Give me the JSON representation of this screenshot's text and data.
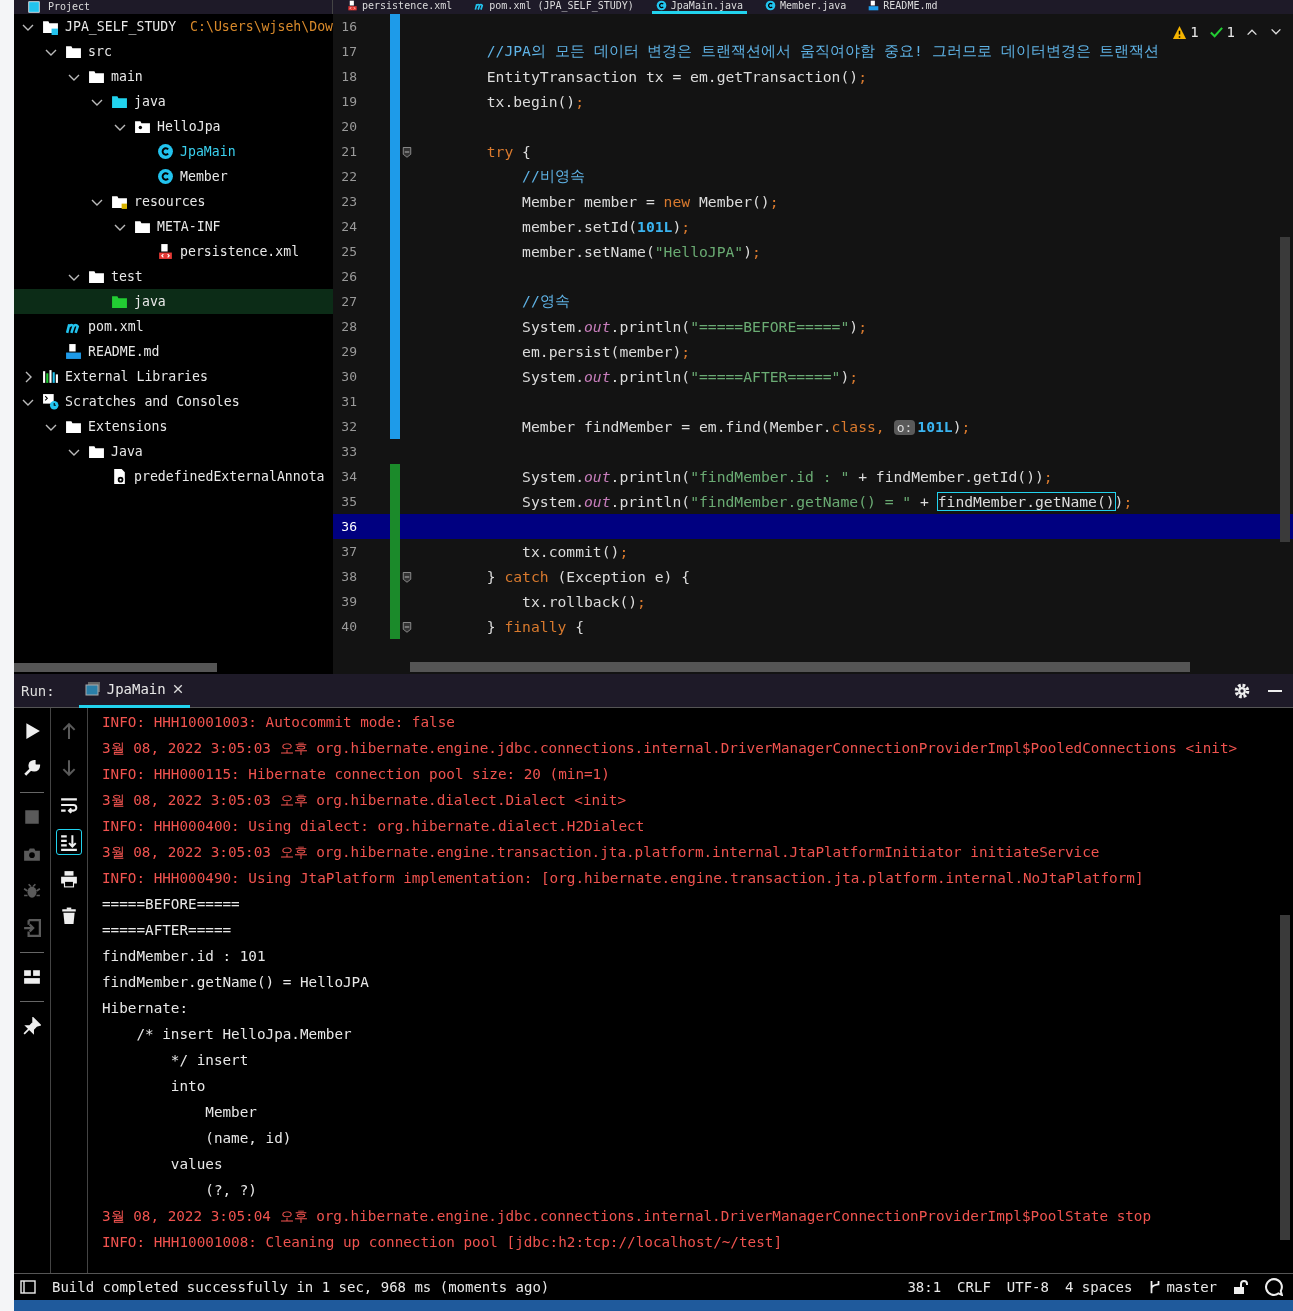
{
  "top_bar": {
    "panel_title": "Project",
    "tabs": [
      {
        "label": "persistence.xml",
        "kind": "xml",
        "selected": false
      },
      {
        "label": "pom.xml (JPA_SELF_STUDY)",
        "kind": "maven",
        "selected": false
      },
      {
        "label": "JpaMain.java",
        "kind": "class",
        "selected": true
      },
      {
        "label": "Member.java",
        "kind": "class",
        "selected": false
      },
      {
        "label": "README.md",
        "kind": "markdown",
        "selected": false
      }
    ]
  },
  "project_tree": [
    {
      "label": "JPA_SELF_STUDY",
      "path": "C:\\Users\\wjseh\\Dow",
      "kind": "module",
      "expanded": true,
      "selected": false,
      "children": [
        {
          "label": "src",
          "kind": "folder",
          "expanded": true,
          "selected": false,
          "children": [
            {
              "label": "main",
              "kind": "folder",
              "expanded": true,
              "selected": false,
              "children": [
                {
                  "label": "java",
                  "kind": "source",
                  "expanded": true,
                  "selected": false,
                  "children": [
                    {
                      "label": "HelloJpa",
                      "kind": "package",
                      "expanded": true,
                      "selected": false,
                      "children": [
                        {
                          "label": "JpaMain",
                          "kind": "class",
                          "active": true,
                          "selected": false
                        },
                        {
                          "label": "Member",
                          "kind": "class",
                          "active": false,
                          "selected": false
                        }
                      ]
                    }
                  ]
                },
                {
                  "label": "resources",
                  "kind": "resources",
                  "expanded": true,
                  "selected": false,
                  "children": [
                    {
                      "label": "META-INF",
                      "kind": "folder",
                      "expanded": true,
                      "selected": false,
                      "children": [
                        {
                          "label": "persistence.xml",
                          "kind": "xml",
                          "selected": false
                        }
                      ]
                    }
                  ]
                }
              ]
            },
            {
              "label": "test",
              "kind": "folder",
              "expanded": true,
              "selected": false,
              "children": [
                {
                  "label": "java",
                  "kind": "test",
                  "selected": true
                }
              ]
            }
          ]
        },
        {
          "label": "pom.xml",
          "kind": "maven",
          "selected": false
        },
        {
          "label": "README.md",
          "kind": "markdown",
          "selected": false
        }
      ]
    },
    {
      "label": "External Libraries",
      "kind": "library",
      "expanded": false,
      "selected": false
    },
    {
      "label": "Scratches and Consoles",
      "kind": "scratches",
      "expanded": true,
      "selected": false,
      "children": [
        {
          "label": "Extensions",
          "kind": "folder",
          "expanded": true,
          "selected": false,
          "children": [
            {
              "label": "Java",
              "kind": "folder",
              "expanded": true,
              "selected": false,
              "children": [
                {
                  "label": "predefinedExternalAnnota",
                  "kind": "config",
                  "selected": false
                }
              ]
            }
          ]
        }
      ]
    }
  ],
  "editor": {
    "inspections": {
      "warnings": "1",
      "passed": "1"
    },
    "lines": [
      {
        "number": "16",
        "modified": true,
        "added": false,
        "fold": false,
        "current": false
      },
      {
        "number": "17",
        "modified": true,
        "added": false,
        "fold": false,
        "current": false,
        "segments": [
          {
            "text": "        //JPA의 모든 데이터 변경은 트랜잭션에서 움직여야함 중요! 그러므로 데이터변경은 트랜잭션",
            "kind": "cmt"
          }
        ]
      },
      {
        "number": "18",
        "modified": true,
        "added": false,
        "fold": false,
        "current": false,
        "segments": [
          {
            "text": "        EntityTransaction tx = em.getTransaction()",
            "kind": "plain"
          },
          {
            "text": ";",
            "kind": "kw"
          }
        ]
      },
      {
        "number": "19",
        "modified": true,
        "added": false,
        "fold": false,
        "current": false,
        "segments": [
          {
            "text": "        tx.begin()",
            "kind": "plain"
          },
          {
            "text": ";",
            "kind": "kw"
          }
        ]
      },
      {
        "number": "20",
        "modified": true,
        "added": false,
        "fold": false,
        "current": false
      },
      {
        "number": "21",
        "modified": true,
        "added": false,
        "fold": true,
        "current": false,
        "segments": [
          {
            "text": "        try",
            "kind": "kw"
          },
          {
            "text": " {",
            "kind": "plain"
          }
        ]
      },
      {
        "number": "22",
        "modified": true,
        "added": false,
        "fold": false,
        "current": false,
        "segments": [
          {
            "text": "            //비영속",
            "kind": "cmt"
          }
        ]
      },
      {
        "number": "23",
        "modified": true,
        "added": false,
        "fold": false,
        "current": false,
        "segments": [
          {
            "text": "            Member member = ",
            "kind": "plain"
          },
          {
            "text": "new",
            "kind": "kw"
          },
          {
            "text": " Member()",
            "kind": "plain"
          },
          {
            "text": ";",
            "kind": "kw"
          }
        ]
      },
      {
        "number": "24",
        "modified": true,
        "added": false,
        "fold": false,
        "current": false,
        "segments": [
          {
            "text": "            member.setId(",
            "kind": "plain"
          },
          {
            "text": "101L",
            "kind": "num"
          },
          {
            "text": ")",
            "kind": "plain"
          },
          {
            "text": ";",
            "kind": "kw"
          }
        ]
      },
      {
        "number": "25",
        "modified": true,
        "added": false,
        "fold": false,
        "current": false,
        "segments": [
          {
            "text": "            member.setName(",
            "kind": "plain"
          },
          {
            "text": "\"HelloJPA\"",
            "kind": "str"
          },
          {
            "text": ")",
            "kind": "plain"
          },
          {
            "text": ";",
            "kind": "kw"
          }
        ]
      },
      {
        "number": "26",
        "modified": true,
        "added": false,
        "fold": false,
        "current": false
      },
      {
        "number": "27",
        "modified": true,
        "added": false,
        "fold": false,
        "current": false,
        "segments": [
          {
            "text": "            //영속",
            "kind": "cmt"
          }
        ]
      },
      {
        "number": "28",
        "modified": true,
        "added": false,
        "fold": false,
        "current": false,
        "segments": [
          {
            "text": "            System.",
            "kind": "plain"
          },
          {
            "text": "out",
            "kind": "field"
          },
          {
            "text": ".println(",
            "kind": "plain"
          },
          {
            "text": "\"=====BEFORE=====\"",
            "kind": "str"
          },
          {
            "text": ")",
            "kind": "plain"
          },
          {
            "text": ";",
            "kind": "kw"
          }
        ]
      },
      {
        "number": "29",
        "modified": true,
        "added": false,
        "fold": false,
        "current": false,
        "segments": [
          {
            "text": "            em.persist(member)",
            "kind": "plain"
          },
          {
            "text": ";",
            "kind": "kw"
          }
        ]
      },
      {
        "number": "30",
        "modified": true,
        "added": false,
        "fold": false,
        "current": false,
        "segments": [
          {
            "text": "            System.",
            "kind": "plain"
          },
          {
            "text": "out",
            "kind": "field"
          },
          {
            "text": ".println(",
            "kind": "plain"
          },
          {
            "text": "\"=====AFTER=====\"",
            "kind": "str"
          },
          {
            "text": ")",
            "kind": "plain"
          },
          {
            "text": ";",
            "kind": "kw"
          }
        ]
      },
      {
        "number": "31",
        "modified": true,
        "added": false,
        "fold": false,
        "current": false
      },
      {
        "number": "32",
        "modified": true,
        "added": false,
        "fold": false,
        "current": false,
        "segments": [
          {
            "text": "            Member findMember = em.find(Member.",
            "kind": "plain"
          },
          {
            "text": "class,",
            "kind": "kw"
          },
          {
            "text": "o:",
            "kind": "hint"
          },
          {
            "text": "101L",
            "kind": "num"
          },
          {
            "text": ")",
            "kind": "plain"
          },
          {
            "text": ";",
            "kind": "kw"
          }
        ]
      },
      {
        "number": "33",
        "modified": false,
        "added": false,
        "fold": false,
        "current": false
      },
      {
        "number": "34",
        "modified": false,
        "added": true,
        "fold": false,
        "current": false,
        "segments": [
          {
            "text": "            System.",
            "kind": "plain"
          },
          {
            "text": "out",
            "kind": "field"
          },
          {
            "text": ".println(",
            "kind": "plain"
          },
          {
            "text": "\"findMember.id : \"",
            "kind": "str"
          },
          {
            "text": " + findMember.getId())",
            "kind": "plain"
          },
          {
            "text": ";",
            "kind": "kw"
          }
        ]
      },
      {
        "number": "35",
        "modified": false,
        "added": true,
        "fold": false,
        "current": false,
        "segments": [
          {
            "text": "            System.",
            "kind": "plain"
          },
          {
            "text": "out",
            "kind": "field"
          },
          {
            "text": ".println(",
            "kind": "plain"
          },
          {
            "text": "\"findMember.getName() = \"",
            "kind": "str"
          },
          {
            "text": " + ",
            "kind": "plain"
          },
          {
            "text": "findMember.getName()",
            "kind": "boxed"
          },
          {
            "text": ")",
            "kind": "plain"
          },
          {
            "text": ";",
            "kind": "kw"
          }
        ]
      },
      {
        "number": "36",
        "modified": false,
        "added": true,
        "fold": false,
        "current": true
      },
      {
        "number": "37",
        "modified": false,
        "added": true,
        "fold": false,
        "current": false,
        "segments": [
          {
            "text": "            tx.commit()",
            "kind": "plain"
          },
          {
            "text": ";",
            "kind": "kw"
          }
        ]
      },
      {
        "number": "38",
        "modified": false,
        "added": true,
        "fold": true,
        "current": false,
        "segments": [
          {
            "text": "        } ",
            "kind": "plain"
          },
          {
            "text": "catch",
            "kind": "kw"
          },
          {
            "text": " (Exception e) {",
            "kind": "plain"
          }
        ]
      },
      {
        "number": "39",
        "modified": false,
        "added": true,
        "fold": false,
        "current": false,
        "segments": [
          {
            "text": "            tx.rollback()",
            "kind": "plain"
          },
          {
            "text": ";",
            "kind": "kw"
          }
        ]
      },
      {
        "number": "40",
        "modified": false,
        "added": true,
        "fold": true,
        "current": false,
        "segments": [
          {
            "text": "        } ",
            "kind": "plain"
          },
          {
            "text": "finally",
            "kind": "kw"
          },
          {
            "text": " {",
            "kind": "plain"
          }
        ]
      }
    ]
  },
  "run_panel": {
    "label": "Run:",
    "tab": {
      "label": "JpaMain",
      "selected": true
    },
    "tools_left": [
      {
        "kind": "run",
        "disabled": false
      },
      {
        "kind": "wrench",
        "disabled": false
      },
      {
        "kind": "stop",
        "disabled": true
      },
      {
        "kind": "camera",
        "disabled": true
      },
      {
        "kind": "bug",
        "disabled": true
      },
      {
        "kind": "exit",
        "disabled": true
      },
      {
        "kind": "layout",
        "disabled": false
      },
      {
        "kind": "pin",
        "disabled": false
      }
    ],
    "tools_right": [
      {
        "kind": "up",
        "disabled": true,
        "selected": false
      },
      {
        "kind": "down",
        "disabled": true,
        "selected": false
      },
      {
        "kind": "wrap",
        "disabled": false,
        "selected": false
      },
      {
        "kind": "scroll-end",
        "disabled": false,
        "selected": true
      },
      {
        "kind": "print",
        "disabled": false,
        "selected": false
      },
      {
        "kind": "trash",
        "disabled": false,
        "selected": false
      }
    ],
    "console": [
      {
        "text": "INFO: HHH10001003: Autocommit mode: false",
        "kind": "err"
      },
      {
        "text": "3월 08, 2022 3:05:03 오후 org.hibernate.engine.jdbc.connections.internal.DriverManagerConnectionProviderImpl$PooledConnections <init>",
        "kind": "err"
      },
      {
        "text": "INFO: HHH000115: Hibernate connection pool size: 20 (min=1)",
        "kind": "err"
      },
      {
        "text": "3월 08, 2022 3:05:03 오후 org.hibernate.dialect.Dialect <init>",
        "kind": "err"
      },
      {
        "text": "INFO: HHH000400: Using dialect: org.hibernate.dialect.H2Dialect",
        "kind": "err"
      },
      {
        "text": "3월 08, 2022 3:05:03 오후 org.hibernate.engine.transaction.jta.platform.internal.JtaPlatformInitiator initiateService",
        "kind": "err"
      },
      {
        "text": "INFO: HHH000490: Using JtaPlatform implementation: [org.hibernate.engine.transaction.jta.platform.internal.NoJtaPlatform]",
        "kind": "err"
      },
      {
        "text": "=====BEFORE=====",
        "kind": "out"
      },
      {
        "text": "=====AFTER=====",
        "kind": "out"
      },
      {
        "text": "findMember.id : 101",
        "kind": "out"
      },
      {
        "text": "findMember.getName() = HelloJPA",
        "kind": "out"
      },
      {
        "text": "Hibernate: ",
        "kind": "out"
      },
      {
        "text": "    /* insert HelloJpa.Member",
        "kind": "out"
      },
      {
        "text": "        */ insert ",
        "kind": "out"
      },
      {
        "text": "        into",
        "kind": "out"
      },
      {
        "text": "            Member",
        "kind": "out"
      },
      {
        "text": "            (name, id) ",
        "kind": "out"
      },
      {
        "text": "        values",
        "kind": "out"
      },
      {
        "text": "            (?, ?)",
        "kind": "out"
      },
      {
        "text": "3월 08, 2022 3:05:04 오후 org.hibernate.engine.jdbc.connections.internal.DriverManagerConnectionProviderImpl$PoolState stop",
        "kind": "err"
      },
      {
        "text": "INFO: HHH10001008: Cleaning up connection pool [jdbc:h2:tcp://localhost/~/test]",
        "kind": "err"
      }
    ]
  },
  "status_bar": {
    "message": "Build completed successfully in 1 sec, 968 ms (moments ago)",
    "position": "38:1",
    "line_separator": "CRLF",
    "encoding": "UTF-8",
    "indent": "4 spaces",
    "branch": "master"
  }
}
